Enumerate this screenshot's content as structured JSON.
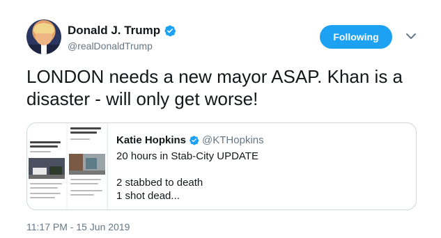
{
  "tweet": {
    "author": {
      "display_name": "Donald J. Trump",
      "handle": "@realDonaldTrump",
      "verified": true
    },
    "follow_button_label": "Following",
    "menu_icon": "chevron-down-icon",
    "text": "LONDON needs a new mayor ASAP. Khan is a disaster - will only get worse!",
    "timestamp": "11:17 PM - 15 Jun 2019"
  },
  "quote": {
    "author": {
      "display_name": "Katie Hopkins",
      "handle": "@KTHopkins",
      "verified": true
    },
    "lines": [
      "20 hours in Stab-City UPDATE",
      "",
      "2 stabbed to death",
      "1 shot dead..."
    ],
    "thumbnail": "news-articles-image"
  },
  "colors": {
    "accent": "#1da1f2",
    "text": "#14171a",
    "muted": "#657786",
    "border": "#ccd6dd"
  }
}
